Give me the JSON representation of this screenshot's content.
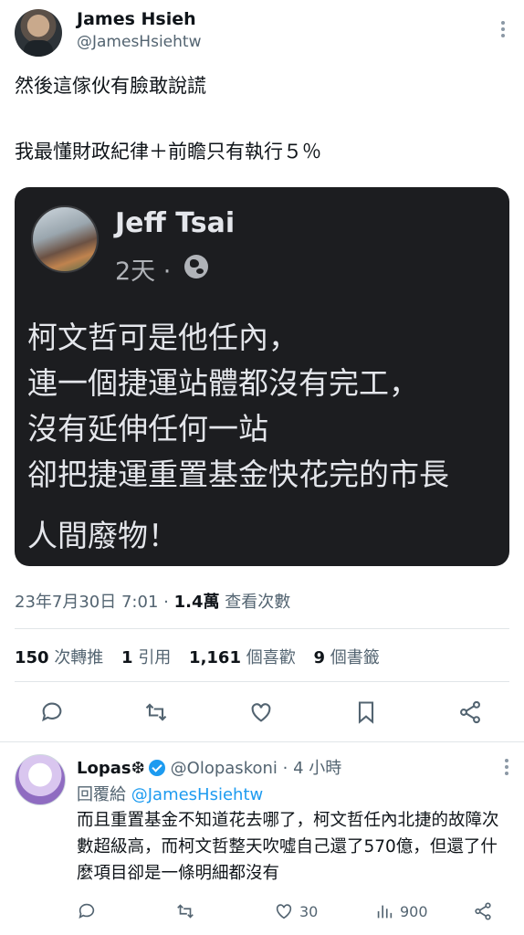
{
  "tweet": {
    "author_name": "James Hsieh",
    "author_handle": "@JamesHsiehtw",
    "text": "然後這傢伙有臉敢說謊\n\n我最懂財政紀律＋前瞻只有執行５％",
    "timestamp": "23年7月30日 7:01",
    "views_count": "1.4萬",
    "views_label": "查看次數",
    "stats": {
      "retweets": "150",
      "retweets_label": "次轉推",
      "quotes": "1",
      "quotes_label": "引用",
      "likes": "1,161",
      "likes_label": "個喜歡",
      "bookmarks": "9",
      "bookmarks_label": "個書籤"
    }
  },
  "embedded_post": {
    "name": "Jeff Tsai",
    "time": "2天 ·",
    "body": "柯文哲可是他任內，\n連一個捷運站體都沒有完工，\n沒有延伸任何一站\n卻把捷運重置基金快花完的市長",
    "footer": "人間廢物！"
  },
  "actions": {
    "icons": [
      "reply-icon",
      "retweet-icon",
      "like-icon",
      "bookmark-icon",
      "share-icon"
    ]
  },
  "reply": {
    "name": "Lopas❆",
    "handle": "@Olopaskoni",
    "time": "· 4 小時",
    "reply_to_label": "回覆給",
    "reply_to_handle": "@JamesHsiehtw",
    "text": "而且重置基金不知道花去哪了，柯文哲任內北捷的故障次數超級高，而柯文哲整天吹噓自己還了570億，但還了什麼項目卻是一條明細都沒有",
    "likes": "30",
    "views": "900"
  },
  "colors": {
    "text": "#0f1419",
    "secondary": "#536471",
    "accent": "#1d9bf0",
    "image_bg": "#1c1d20"
  }
}
